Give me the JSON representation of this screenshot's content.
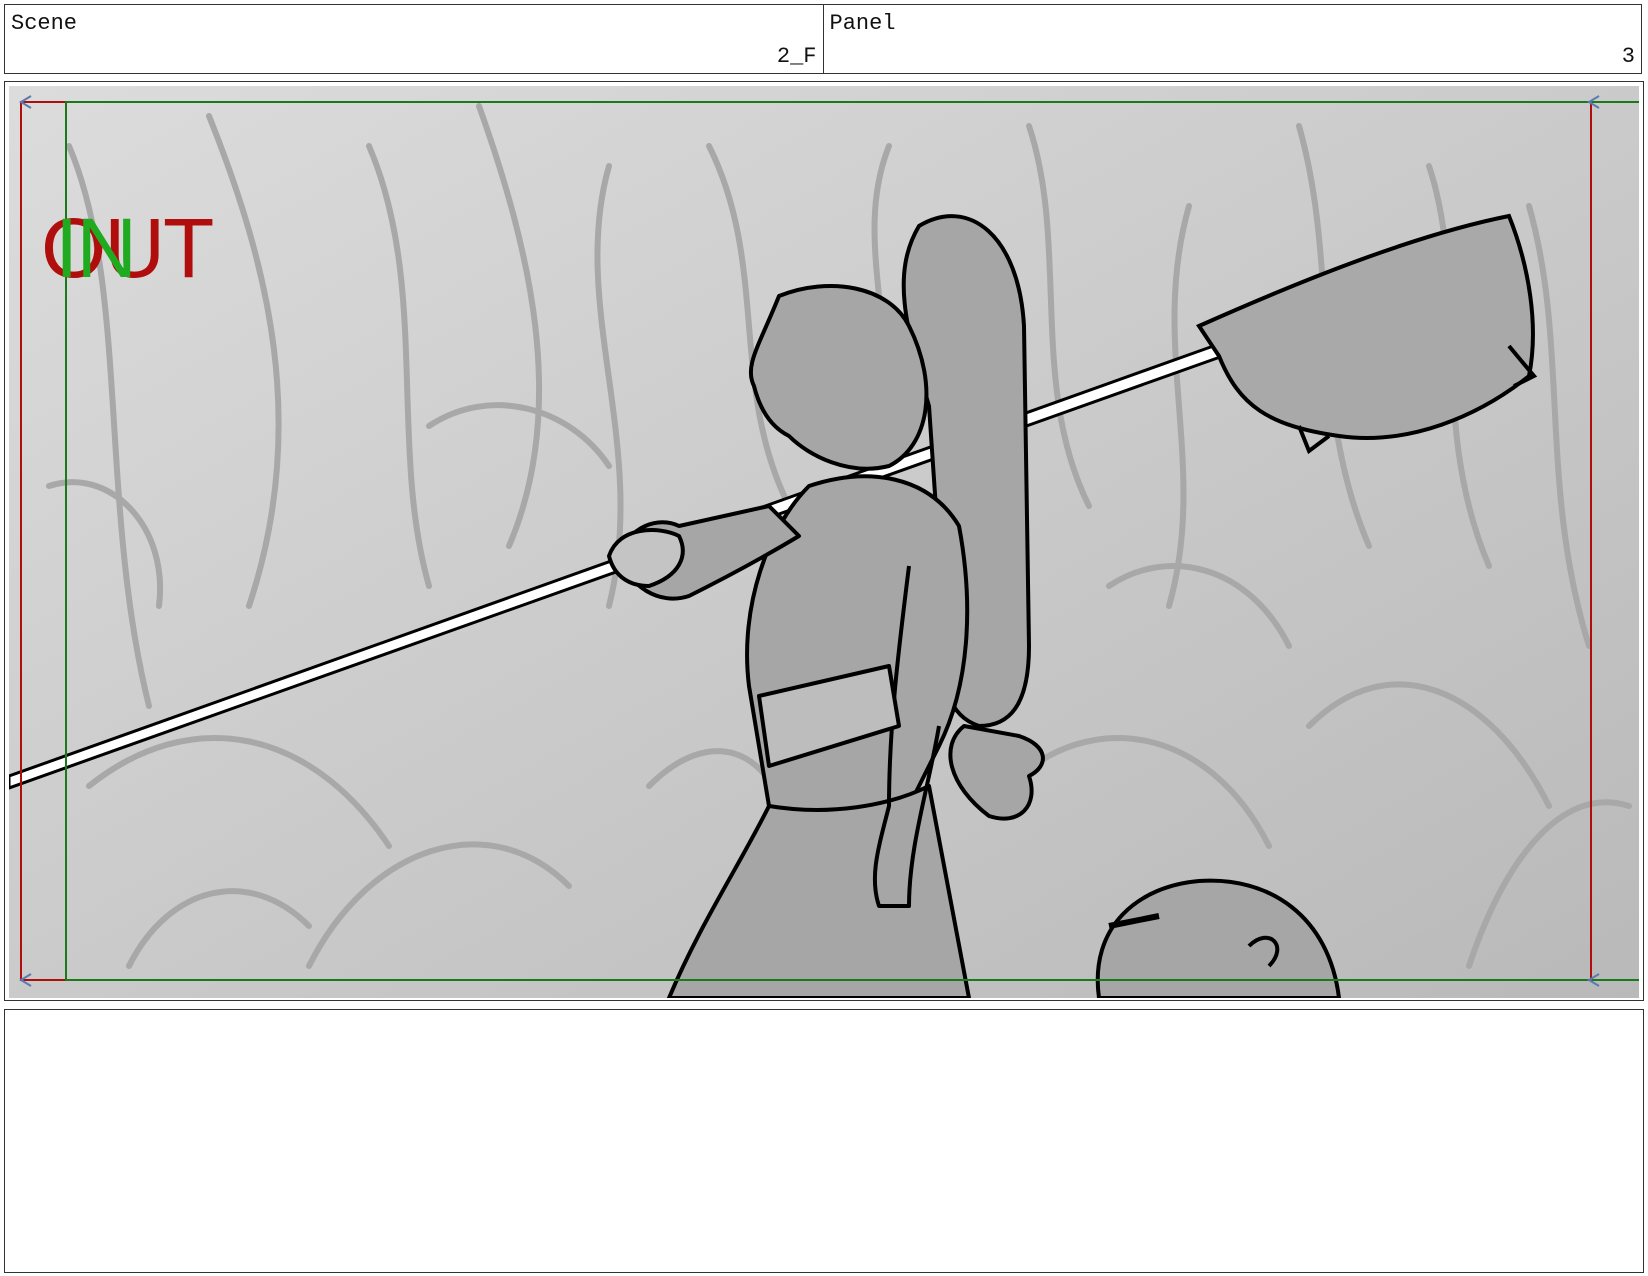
{
  "header": {
    "scene_label": "Scene",
    "scene_value": "2_F",
    "panel_label": "Panel",
    "panel_value": "3"
  },
  "frame_markers": {
    "out_text": "OUT",
    "in_text": "IN",
    "out_color": "#b00d0d",
    "in_color": "#1faa1f"
  },
  "notes": {
    "text": ""
  }
}
